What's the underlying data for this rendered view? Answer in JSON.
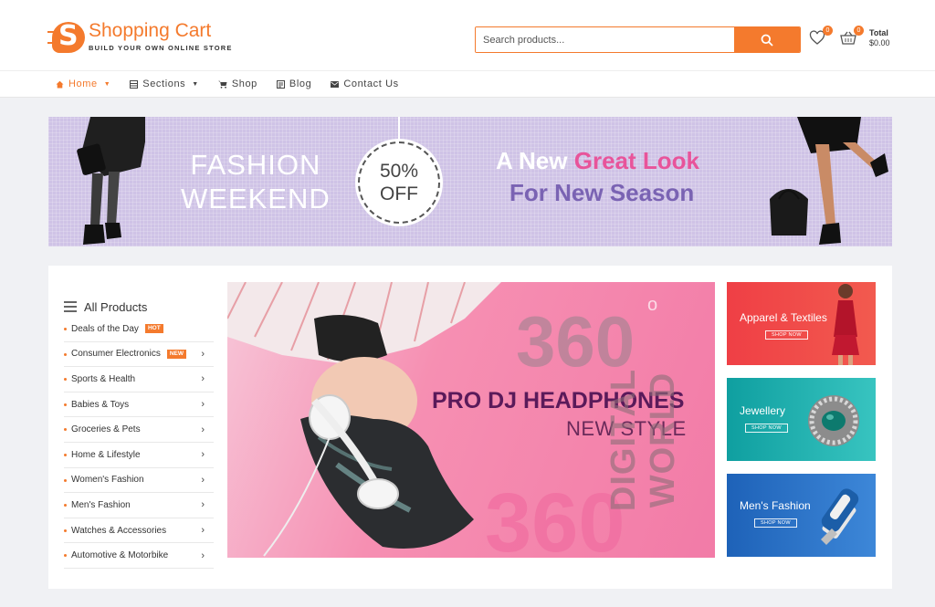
{
  "header": {
    "logo_title": "Shopping Cart",
    "logo_subtitle": "BUILD YOUR OWN ONLINE STORE",
    "search_placeholder": "Search products...",
    "wishlist_count": "0",
    "cart_count": "0",
    "total_label": "Total",
    "total_value": "$0.00"
  },
  "nav": {
    "items": [
      {
        "label": "Home",
        "icon": "home-icon",
        "active": true
      },
      {
        "label": "Sections",
        "icon": "grid-icon"
      },
      {
        "label": "Shop",
        "icon": "cart-icon"
      },
      {
        "label": "Blog",
        "icon": "blog-icon"
      },
      {
        "label": "Contact Us",
        "icon": "mail-icon"
      }
    ]
  },
  "promo": {
    "left_line1": "FASHION",
    "left_line2": "WEEKEND",
    "tag_line1": "50%",
    "tag_line2": "OFF",
    "headline_white": "A New",
    "headline_pink": "Great Look",
    "subline": "For New Season"
  },
  "categories": {
    "title": "All Products",
    "items": [
      {
        "label": "Deals of the Day",
        "badge": "HOT"
      },
      {
        "label": "Consumer Electronics",
        "badge": "NEW"
      },
      {
        "label": "Sports & Health"
      },
      {
        "label": "Babies & Toys"
      },
      {
        "label": "Groceries & Pets"
      },
      {
        "label": "Home & Lifestyle"
      },
      {
        "label": "Women's Fashion"
      },
      {
        "label": "Men's Fashion"
      },
      {
        "label": "Watches & Accessories"
      },
      {
        "label": "Automotive & Motorbike"
      }
    ]
  },
  "hero": {
    "bg_number_top": "360",
    "degree": "o",
    "bg_number_bottom": "360",
    "title": "PRO DJ HEADPHONES",
    "subtitle": "NEW STYLE",
    "vertical_text": "DIGITAL WORLD"
  },
  "side_banners": [
    {
      "label": "Apparel & Textiles",
      "cta": "SHOP NOW"
    },
    {
      "label": "Jewellery",
      "cta": "SHOP NOW"
    },
    {
      "label": "Men's Fashion",
      "cta": "SHOP NOW"
    }
  ],
  "colors": {
    "accent": "#f47a2d",
    "headline_pink": "#e8549a",
    "subline_purple": "#7a63b3"
  }
}
